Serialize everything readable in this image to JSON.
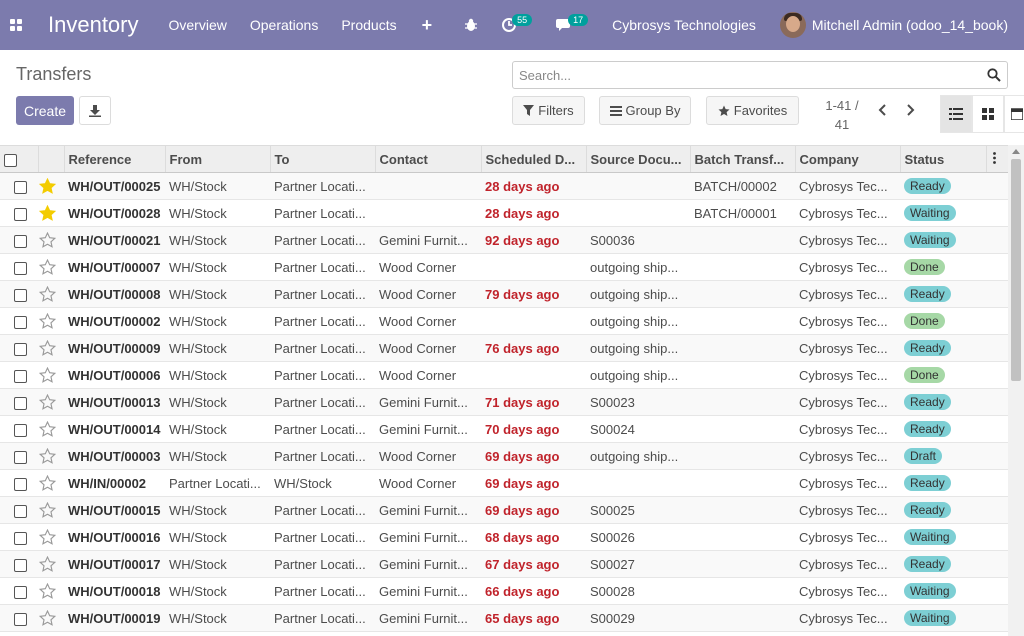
{
  "navbar": {
    "app_name": "Inventory",
    "menus": [
      "Overview",
      "Operations",
      "Products"
    ],
    "plus_label": "+",
    "activity_count": "55",
    "message_count": "17",
    "company": "Cybrosys Technologies",
    "user": "Mitchell Admin (odoo_14_book)"
  },
  "control": {
    "title": "Transfers",
    "create_label": "Create",
    "search_placeholder": "Search...",
    "filters_label": "Filters",
    "groupby_label": "Group By",
    "favorites_label": "Favorites",
    "pager_line1": "1-41 /",
    "pager_line2": "41"
  },
  "table": {
    "columns": [
      "Reference",
      "From",
      "To",
      "Contact",
      "Scheduled D...",
      "Source Docu...",
      "Batch Transf...",
      "Company",
      "Status"
    ],
    "rows": [
      {
        "starred": true,
        "ref": "WH/OUT/00025",
        "from": "WH/Stock",
        "to": "Partner Locati...",
        "contact": "",
        "scheduled": "28 days ago",
        "source": "",
        "batch": "BATCH/00002",
        "company": "Cybrosys Tec...",
        "status": "Ready"
      },
      {
        "starred": true,
        "ref": "WH/OUT/00028",
        "from": "WH/Stock",
        "to": "Partner Locati...",
        "contact": "",
        "scheduled": "28 days ago",
        "source": "",
        "batch": "BATCH/00001",
        "company": "Cybrosys Tec...",
        "status": "Waiting"
      },
      {
        "starred": false,
        "ref": "WH/OUT/00021",
        "from": "WH/Stock",
        "to": "Partner Locati...",
        "contact": "Gemini Furnit...",
        "scheduled": "92 days ago",
        "source": "S00036",
        "batch": "",
        "company": "Cybrosys Tec...",
        "status": "Waiting"
      },
      {
        "starred": false,
        "ref": "WH/OUT/00007",
        "from": "WH/Stock",
        "to": "Partner Locati...",
        "contact": "Wood Corner",
        "scheduled": "",
        "source": "outgoing ship...",
        "batch": "",
        "company": "Cybrosys Tec...",
        "status": "Done"
      },
      {
        "starred": false,
        "ref": "WH/OUT/00008",
        "from": "WH/Stock",
        "to": "Partner Locati...",
        "contact": "Wood Corner",
        "scheduled": "79 days ago",
        "source": "outgoing ship...",
        "batch": "",
        "company": "Cybrosys Tec...",
        "status": "Ready"
      },
      {
        "starred": false,
        "ref": "WH/OUT/00002",
        "from": "WH/Stock",
        "to": "Partner Locati...",
        "contact": "Wood Corner",
        "scheduled": "",
        "source": "outgoing ship...",
        "batch": "",
        "company": "Cybrosys Tec...",
        "status": "Done"
      },
      {
        "starred": false,
        "ref": "WH/OUT/00009",
        "from": "WH/Stock",
        "to": "Partner Locati...",
        "contact": "Wood Corner",
        "scheduled": "76 days ago",
        "source": "outgoing ship...",
        "batch": "",
        "company": "Cybrosys Tec...",
        "status": "Ready"
      },
      {
        "starred": false,
        "ref": "WH/OUT/00006",
        "from": "WH/Stock",
        "to": "Partner Locati...",
        "contact": "Wood Corner",
        "scheduled": "",
        "source": "outgoing ship...",
        "batch": "",
        "company": "Cybrosys Tec...",
        "status": "Done"
      },
      {
        "starred": false,
        "ref": "WH/OUT/00013",
        "from": "WH/Stock",
        "to": "Partner Locati...",
        "contact": "Gemini Furnit...",
        "scheduled": "71 days ago",
        "source": "S00023",
        "batch": "",
        "company": "Cybrosys Tec...",
        "status": "Ready"
      },
      {
        "starred": false,
        "ref": "WH/OUT/00014",
        "from": "WH/Stock",
        "to": "Partner Locati...",
        "contact": "Gemini Furnit...",
        "scheduled": "70 days ago",
        "source": "S00024",
        "batch": "",
        "company": "Cybrosys Tec...",
        "status": "Ready"
      },
      {
        "starred": false,
        "ref": "WH/OUT/00003",
        "from": "WH/Stock",
        "to": "Partner Locati...",
        "contact": "Wood Corner",
        "scheduled": "69 days ago",
        "source": "outgoing ship...",
        "batch": "",
        "company": "Cybrosys Tec...",
        "status": "Draft"
      },
      {
        "starred": false,
        "ref": "WH/IN/00002",
        "from": "Partner Locati...",
        "to": "WH/Stock",
        "contact": "Wood Corner",
        "scheduled": "69 days ago",
        "source": "",
        "batch": "",
        "company": "Cybrosys Tec...",
        "status": "Ready"
      },
      {
        "starred": false,
        "ref": "WH/OUT/00015",
        "from": "WH/Stock",
        "to": "Partner Locati...",
        "contact": "Gemini Furnit...",
        "scheduled": "69 days ago",
        "source": "S00025",
        "batch": "",
        "company": "Cybrosys Tec...",
        "status": "Ready"
      },
      {
        "starred": false,
        "ref": "WH/OUT/00016",
        "from": "WH/Stock",
        "to": "Partner Locati...",
        "contact": "Gemini Furnit...",
        "scheduled": "68 days ago",
        "source": "S00026",
        "batch": "",
        "company": "Cybrosys Tec...",
        "status": "Waiting"
      },
      {
        "starred": false,
        "ref": "WH/OUT/00017",
        "from": "WH/Stock",
        "to": "Partner Locati...",
        "contact": "Gemini Furnit...",
        "scheduled": "67 days ago",
        "source": "S00027",
        "batch": "",
        "company": "Cybrosys Tec...",
        "status": "Ready"
      },
      {
        "starred": false,
        "ref": "WH/OUT/00018",
        "from": "WH/Stock",
        "to": "Partner Locati...",
        "contact": "Gemini Furnit...",
        "scheduled": "66 days ago",
        "source": "S00028",
        "batch": "",
        "company": "Cybrosys Tec...",
        "status": "Waiting"
      },
      {
        "starred": false,
        "ref": "WH/OUT/00019",
        "from": "WH/Stock",
        "to": "Partner Locati...",
        "contact": "Gemini Furnit...",
        "scheduled": "65 days ago",
        "source": "S00029",
        "batch": "",
        "company": "Cybrosys Tec...",
        "status": "Waiting"
      }
    ]
  },
  "colors": {
    "navbar": "#7c7bad",
    "primary_button": "#7c7bad",
    "late_date": "#c0232b",
    "star_filled": "#f3cc00",
    "status_ready": "#7dcfd4",
    "status_done": "#a6d8a6"
  }
}
